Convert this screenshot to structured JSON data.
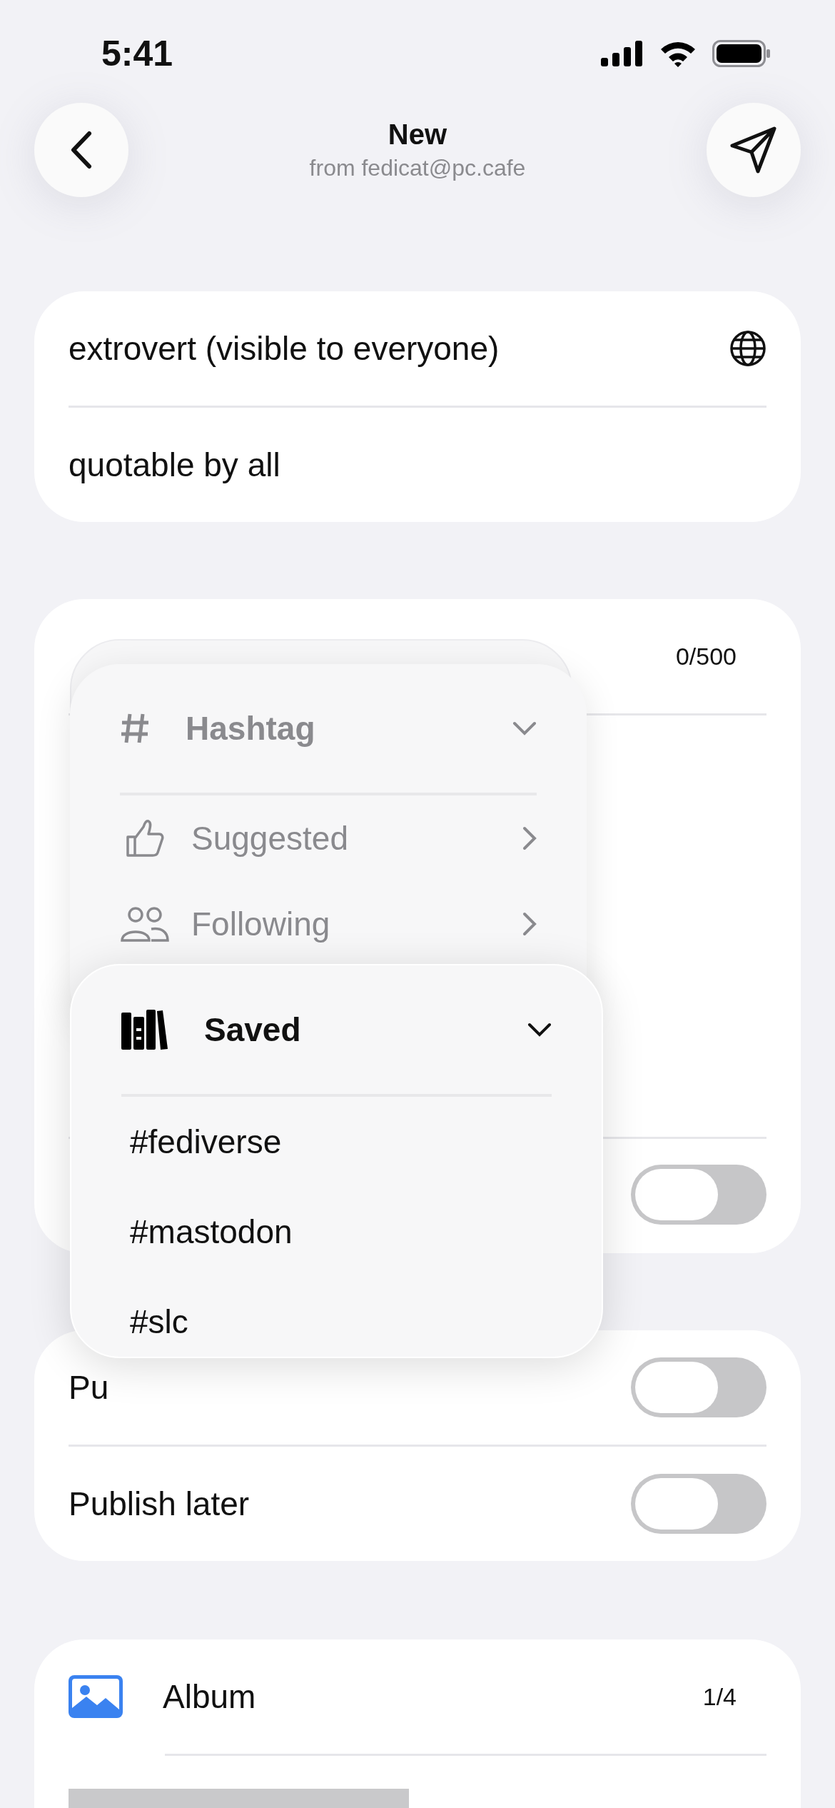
{
  "status_bar": {
    "time": "5:41"
  },
  "header": {
    "title": "New",
    "subtitle": "from fedicat@pc.cafe"
  },
  "audience": [
    {
      "label": "extrovert (visible to everyone)",
      "kind": "globe"
    },
    {
      "label": "quotable by all",
      "kind": "plain"
    }
  ],
  "compose": {
    "counter": "0/500",
    "toggle_on": false
  },
  "options": [
    {
      "label": "Pu",
      "on": false
    },
    {
      "label": "Publish later",
      "on": false
    }
  ],
  "album": {
    "label": "Album",
    "count": "1/4"
  },
  "hashtag_menu": {
    "title": "Hashtag",
    "items": [
      {
        "label": "Suggested",
        "kind": "thumb"
      },
      {
        "label": "Following",
        "kind": "people"
      }
    ]
  },
  "saved_menu": {
    "title": "Saved",
    "tags": [
      "#fediverse",
      "#mastodon",
      "#slc"
    ]
  }
}
